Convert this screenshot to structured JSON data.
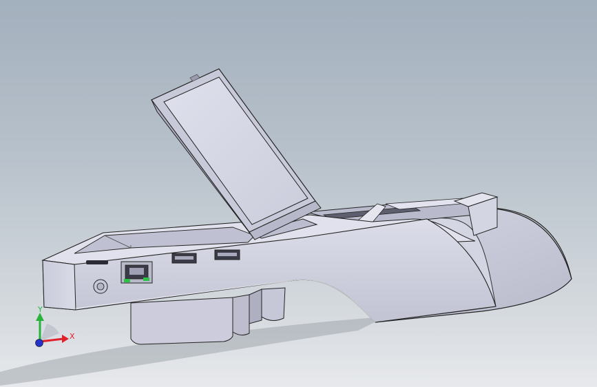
{
  "viewport": {
    "background_top": "#a3b0bd",
    "background_bottom": "#e7e9ec",
    "model_color": "#d2d3e2"
  },
  "model": {
    "parts": [
      "base-housing",
      "tilt-display",
      "ethernet-port",
      "usb-port-1",
      "usb-port-2",
      "power-jack",
      "paper-cover",
      "printer-head-block",
      "foot-block"
    ]
  },
  "triad": {
    "x_label": "X",
    "y_label": "Y",
    "x_color": "#e0202a",
    "y_color": "#28b43c",
    "z_color": "#2432c8"
  }
}
